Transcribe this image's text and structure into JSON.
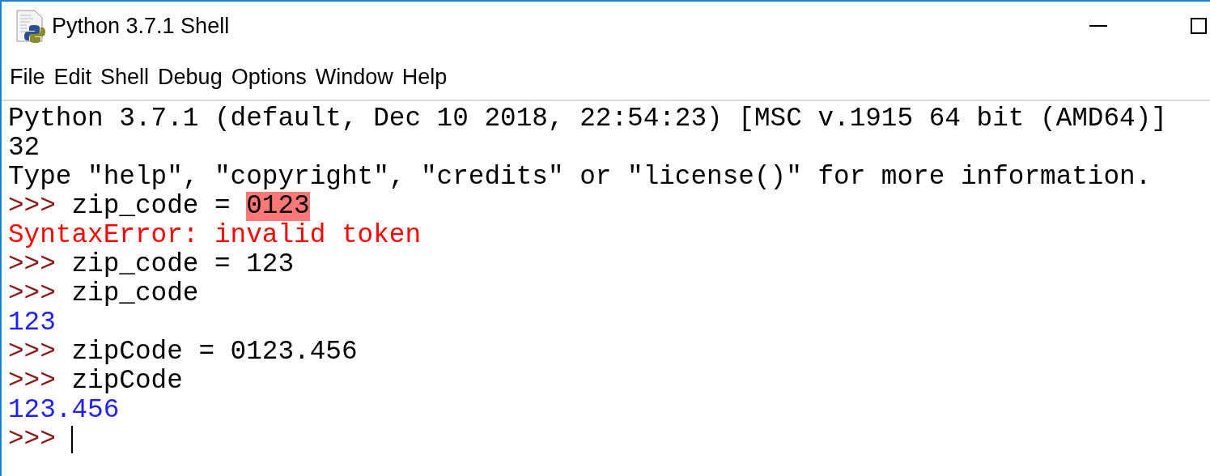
{
  "window": {
    "title": "Python 3.7.1 Shell"
  },
  "menu": [
    {
      "label": "File"
    },
    {
      "label": "Edit"
    },
    {
      "label": "Shell"
    },
    {
      "label": "Debug"
    },
    {
      "label": "Options"
    },
    {
      "label": "Window"
    },
    {
      "label": "Help"
    }
  ],
  "shell": {
    "lines": [
      {
        "segments": [
          {
            "kind": "info",
            "text": "Python 3.7.1 (default, Dec 10 2018, 22:54:23) [MSC v.1915 64 bit (AMD64)]"
          }
        ]
      },
      {
        "segments": [
          {
            "kind": "info",
            "text": "32"
          }
        ]
      },
      {
        "segments": [
          {
            "kind": "info",
            "text": "Type \"help\", \"copyright\", \"credits\" or \"license()\" for more information."
          }
        ]
      },
      {
        "segments": [
          {
            "kind": "prompt",
            "text": ">>>"
          },
          {
            "kind": "input",
            "text": "zip_code ="
          },
          {
            "kind": "input",
            "text": "0123",
            "highlighted": true
          }
        ]
      },
      {
        "segments": [
          {
            "kind": "error",
            "text": "SyntaxError: invalid token"
          }
        ]
      },
      {
        "segments": [
          {
            "kind": "prompt",
            "text": ">>>"
          },
          {
            "kind": "input",
            "text": "zip_code = 123"
          }
        ]
      },
      {
        "segments": [
          {
            "kind": "prompt",
            "text": ">>>"
          },
          {
            "kind": "input",
            "text": "zip_code"
          }
        ]
      },
      {
        "segments": [
          {
            "kind": "output",
            "text": "123"
          }
        ]
      },
      {
        "segments": [
          {
            "kind": "prompt",
            "text": ">>>"
          },
          {
            "kind": "input",
            "text": "zipCode = 0123.456"
          }
        ]
      },
      {
        "segments": [
          {
            "kind": "prompt",
            "text": ">>>"
          },
          {
            "kind": "input",
            "text": "zipCode"
          }
        ]
      },
      {
        "segments": [
          {
            "kind": "output",
            "text": "123.456"
          }
        ]
      },
      {
        "segments": [
          {
            "kind": "prompt",
            "text": ">>>"
          }
        ],
        "cursor": true
      }
    ]
  }
}
